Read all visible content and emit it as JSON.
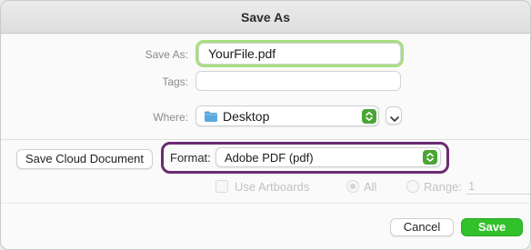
{
  "dialog": {
    "title": "Save As"
  },
  "save_as": {
    "label": "Save As:",
    "value": "YourFile.pdf"
  },
  "tags": {
    "label": "Tags:",
    "value": ""
  },
  "where": {
    "label": "Where:",
    "value": "Desktop",
    "icon": "folder-icon"
  },
  "save_cloud_button": {
    "label": "Save Cloud Document"
  },
  "format": {
    "label": "Format:",
    "value": "Adobe PDF (pdf)"
  },
  "options": {
    "use_artboards_label": "Use Artboards",
    "all_label": "All",
    "range_label": "Range:",
    "range_value": "1"
  },
  "footer": {
    "cancel_label": "Cancel",
    "save_label": "Save"
  },
  "colors": {
    "focus_ring": "#a6df80",
    "stepper_green": "#4aa536",
    "primary_button": "#31c12b",
    "highlight_frame": "#6b2b73",
    "folder_blue": "#5aa8e0"
  }
}
